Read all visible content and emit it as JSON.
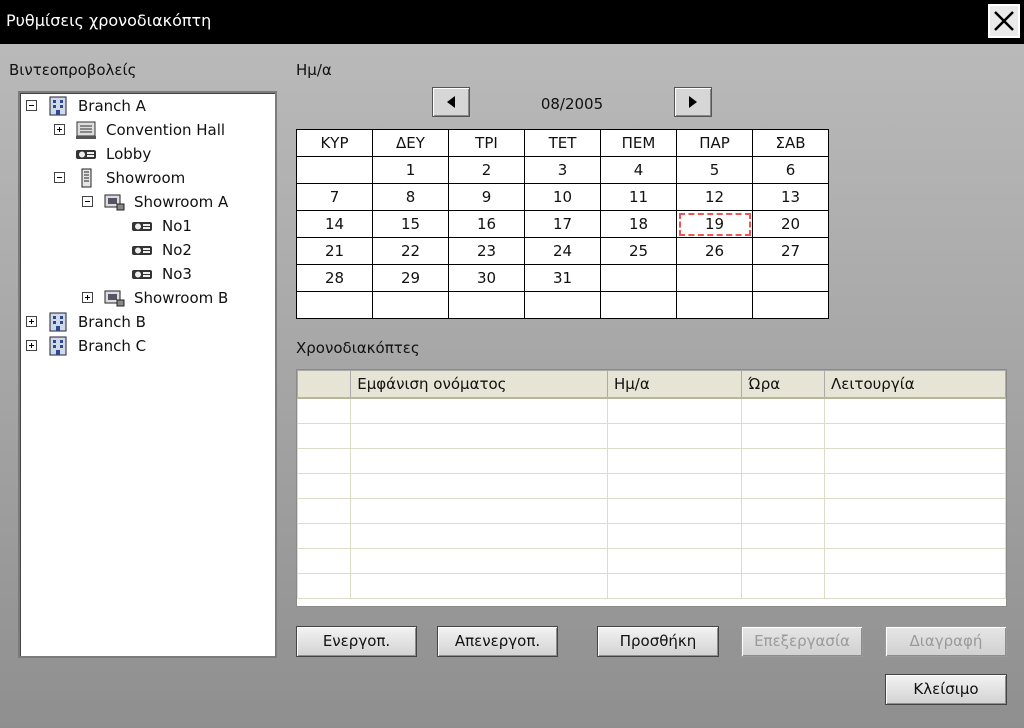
{
  "window": {
    "title": "Ρυθμίσεις χρονοδιακόπτη"
  },
  "left": {
    "label": "Βιντεοπροβολείς",
    "tree": [
      {
        "label": "Branch A",
        "icon": "building-icon"
      },
      {
        "label": "Convention Hall",
        "icon": "hall-icon"
      },
      {
        "label": "Lobby",
        "icon": "projector-icon"
      },
      {
        "label": "Showroom",
        "icon": "tower-icon"
      },
      {
        "label": "Showroom A",
        "icon": "room-icon"
      },
      {
        "label": "No1",
        "icon": "projector-icon"
      },
      {
        "label": "No2",
        "icon": "projector-icon"
      },
      {
        "label": "No3",
        "icon": "projector-icon"
      },
      {
        "label": "Showroom B",
        "icon": "room-icon"
      },
      {
        "label": "Branch B",
        "icon": "building-icon"
      },
      {
        "label": "Branch C",
        "icon": "building-icon"
      }
    ]
  },
  "calendar": {
    "label": "Ημ/α",
    "month": "08/2005",
    "days": [
      "ΚΥΡ",
      "ΔΕΥ",
      "ΤΡΙ",
      "ΤΕΤ",
      "ΠΕΜ",
      "ΠΑΡ",
      "ΣΑΒ"
    ],
    "weeks": [
      [
        "",
        "1",
        "2",
        "3",
        "4",
        "5",
        "6"
      ],
      [
        "7",
        "8",
        "9",
        "10",
        "11",
        "12",
        "13"
      ],
      [
        "14",
        "15",
        "16",
        "17",
        "18",
        "19",
        "20"
      ],
      [
        "21",
        "22",
        "23",
        "24",
        "25",
        "26",
        "27"
      ],
      [
        "28",
        "29",
        "30",
        "31",
        "",
        "",
        ""
      ],
      [
        "",
        "",
        "",
        "",
        "",
        "",
        ""
      ]
    ],
    "selected": "19"
  },
  "timers": {
    "label": "Χρονοδιακόπτες",
    "columns": [
      "",
      "Εμφάνιση ονόματος",
      "Ημ/α",
      "Ώρα",
      "Λειτουργία"
    ]
  },
  "buttons": {
    "enable": "Ενεργοπ.",
    "disable": "Απενεργοπ.",
    "add": "Προσθήκη",
    "edit": "Επεξεργασία",
    "delete": "Διαγραφή",
    "close": "Κλείσιμο"
  }
}
